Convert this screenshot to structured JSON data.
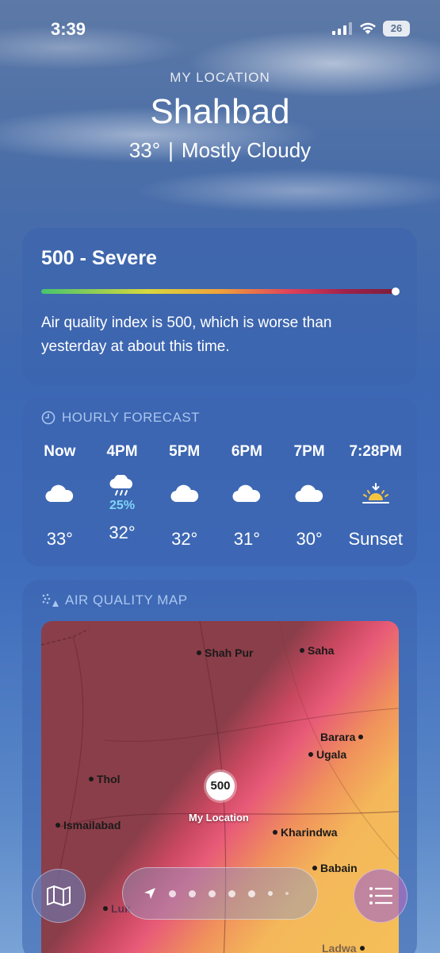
{
  "status_bar": {
    "time": "3:39",
    "battery": "26"
  },
  "header": {
    "location_label": "MY LOCATION",
    "city": "Shahbad",
    "temperature": "33°",
    "separator": "|",
    "condition": "Mostly Cloudy"
  },
  "aqi": {
    "title": "500 - Severe",
    "level_fraction": 1.0,
    "description": "Air quality index is 500, which is worse than yesterday at about this time."
  },
  "hourly": {
    "heading": "HOURLY FORECAST",
    "items": [
      {
        "time": "Now",
        "icon": "cloud-icon",
        "precip": "",
        "temp": "33°"
      },
      {
        "time": "4PM",
        "icon": "cloud-rain-icon",
        "precip": "25%",
        "temp": "32°"
      },
      {
        "time": "5PM",
        "icon": "cloud-icon",
        "precip": "",
        "temp": "32°"
      },
      {
        "time": "6PM",
        "icon": "cloud-icon",
        "precip": "",
        "temp": "31°"
      },
      {
        "time": "7PM",
        "icon": "cloud-icon",
        "precip": "",
        "temp": "30°"
      },
      {
        "time": "7:28PM",
        "icon": "sunset-icon",
        "precip": "",
        "temp": "Sunset"
      }
    ]
  },
  "air_map": {
    "heading": "AIR QUALITY MAP",
    "marker_value": "500",
    "marker_label": "My Location",
    "places": [
      "Shah Pur",
      "Saha",
      "Barara",
      "Ugala",
      "Thol",
      "Ismailabad",
      "Kharindwa",
      "Babain",
      "Luk",
      "Ladwa"
    ]
  },
  "colors": {
    "accent_precip": "#7fd5f7",
    "aqi_severe": "#7a1d3a"
  }
}
